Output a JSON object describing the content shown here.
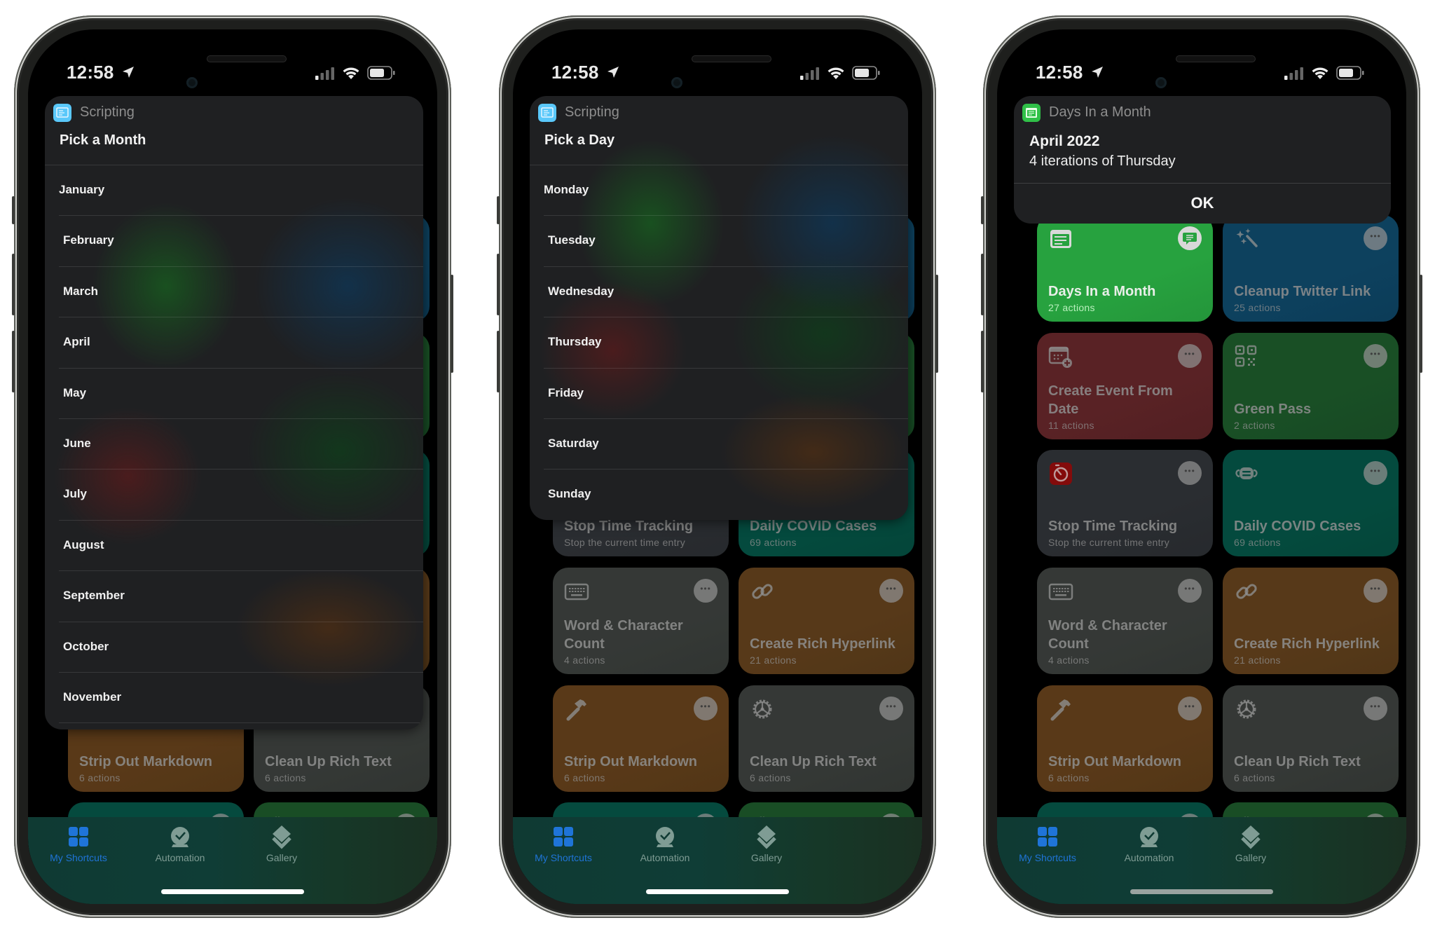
{
  "status_bar": {
    "time": "12:58",
    "icons": [
      "location-arrow-icon",
      "cellular-signal-icon",
      "wifi-icon",
      "battery-icon"
    ]
  },
  "colors": {
    "scripting_icon": "#5ac8fa",
    "days_in_month_icon": "#30c048",
    "tab_active": "#1f74d8",
    "tab_inactive": "#7f9c94"
  },
  "phones": [
    {
      "sheet": {
        "app_name": "Scripting",
        "app_icon": "scripting-icon",
        "prompt": "Pick a Month",
        "options": [
          "January",
          "February",
          "March",
          "April",
          "May",
          "June",
          "July",
          "August",
          "September",
          "October",
          "November"
        ]
      }
    },
    {
      "sheet": {
        "app_name": "Scripting",
        "app_icon": "scripting-icon",
        "prompt": "Pick a Day",
        "options": [
          "Monday",
          "Tuesday",
          "Wednesday",
          "Thursday",
          "Friday",
          "Saturday",
          "Sunday"
        ]
      }
    },
    {
      "alert": {
        "app_name": "Days In a Month",
        "app_icon": "days-in-month-icon",
        "title": "April 2022",
        "message": "4 iterations of Thursday",
        "ok_label": "OK"
      }
    }
  ],
  "shortcuts": [
    {
      "name": "Days In a Month",
      "subtitle": "27 actions",
      "icon": "text-document-icon",
      "color": "#27a23f",
      "action_icon": "speech-bubble-icon",
      "highlighted": true
    },
    {
      "name": "Cleanup Twitter Link",
      "subtitle": "25 actions",
      "icon": "magic-wand-icon",
      "color": "#0e4564",
      "action_icon": "more-icon"
    },
    {
      "name": "Create Event From Date",
      "subtitle": "11 actions",
      "icon": "calendar-add-icon",
      "color": "#5e2427",
      "action_icon": "more-icon"
    },
    {
      "name": "Green Pass",
      "subtitle": "2 actions",
      "icon": "qr-code-icon",
      "color": "#1b5428",
      "action_icon": "more-icon"
    },
    {
      "name": "Stop Time Tracking",
      "subtitle": "Stop the current time entry",
      "icon": "timer-icon",
      "color": "#2d3034",
      "action_icon": "more-icon"
    },
    {
      "name": "Daily COVID Cases",
      "subtitle": "69 actions",
      "icon": "face-mask-icon",
      "color": "#054f42",
      "action_icon": "more-icon"
    },
    {
      "name": "Word & Character Count",
      "subtitle": "4 actions",
      "icon": "keyboard-icon",
      "color": "#383c39",
      "action_icon": "more-icon"
    },
    {
      "name": "Create Rich Hyperlink",
      "subtitle": "21 actions",
      "icon": "link-icon",
      "color": "#5c3d1b",
      "action_icon": "more-icon"
    },
    {
      "name": "Strip Out Markdown",
      "subtitle": "6 actions",
      "icon": "hammer-icon",
      "color": "#5e3d1a",
      "action_icon": "more-icon"
    },
    {
      "name": "Clean Up Rich Text",
      "subtitle": "6 actions",
      "icon": "gear-icon",
      "color": "#383c39",
      "action_icon": "more-icon"
    },
    {
      "name": "",
      "subtitle": "",
      "icon": "chart-icon",
      "color": "#064e42",
      "action_icon": "more-icon"
    },
    {
      "name": "",
      "subtitle": "",
      "icon": "gear-icon",
      "color": "#1b5228",
      "action_icon": "more-icon"
    }
  ],
  "tabbar": {
    "tabs": [
      {
        "label": "My Shortcuts",
        "icon": "grid-icon",
        "active": true
      },
      {
        "label": "Automation",
        "icon": "clock-check-icon",
        "active": false
      },
      {
        "label": "Gallery",
        "icon": "layers-icon",
        "active": false
      }
    ]
  }
}
